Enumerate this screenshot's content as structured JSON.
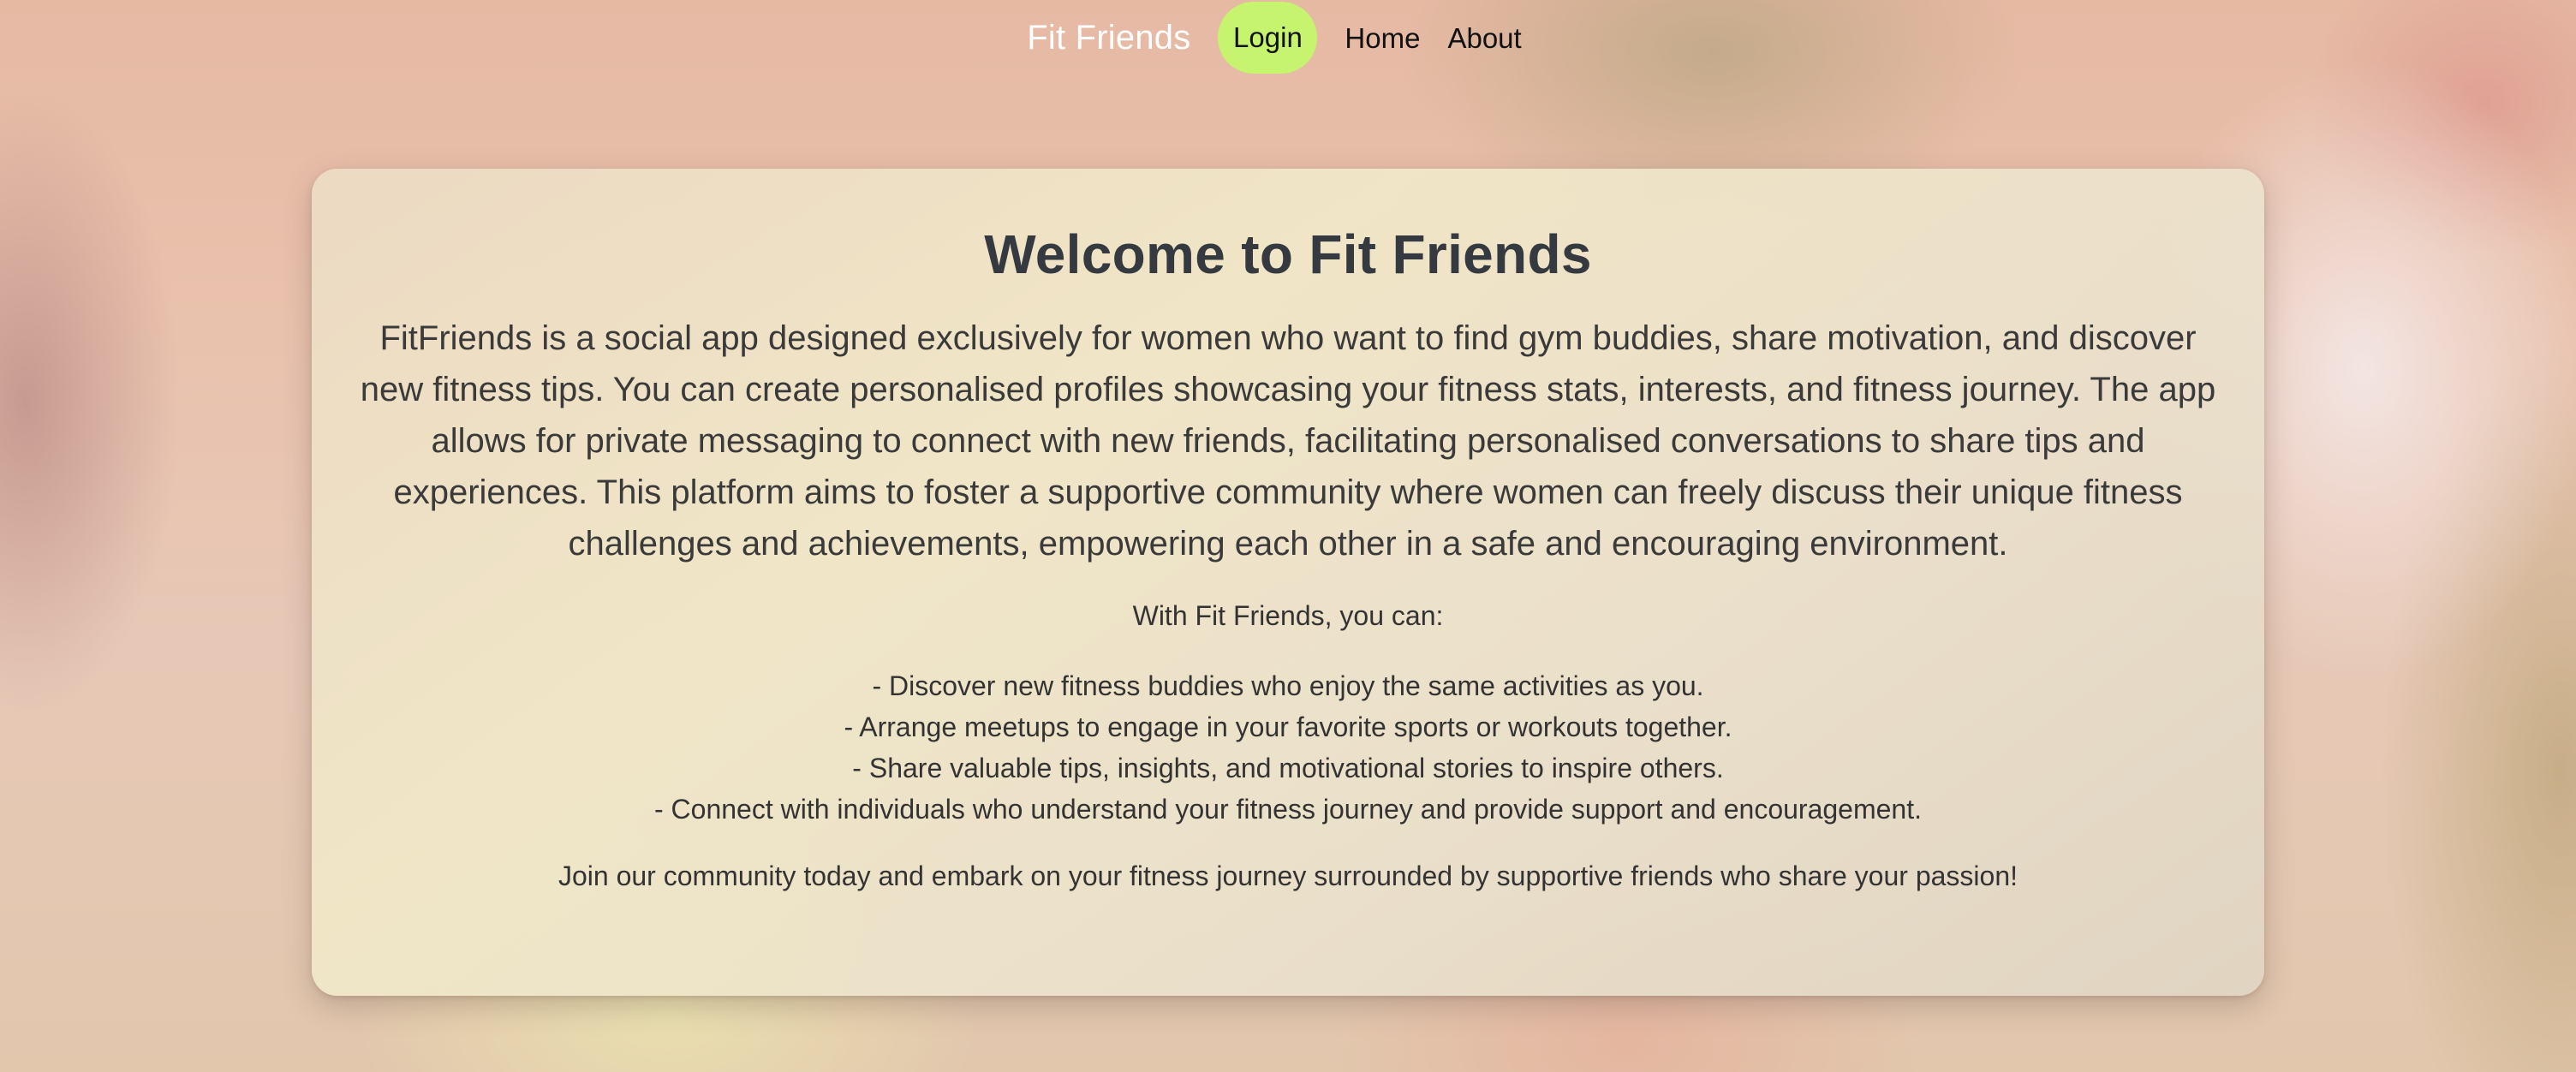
{
  "nav": {
    "brand": "Fit Friends",
    "login": "Login",
    "home": "Home",
    "about": "About",
    "accent_color": "#c6f46e"
  },
  "welcome": {
    "title": "Welcome to Fit Friends",
    "intro": "FitFriends is a social app designed exclusively for women who want to find gym buddies, share motivation, and discover new fitness tips. You can create personalised profiles showcasing your fitness stats, interests, and fitness journey. The app allows for private messaging to connect with new friends, facilitating personalised conversations to share tips and experiences. This platform aims to foster a supportive community where women can freely discuss their unique fitness challenges and achievements, empowering each other in a safe and encouraging environment.",
    "subhead": "With Fit Friends, you can:",
    "features": [
      "- Discover new fitness buddies who enjoy the same activities as you.",
      "- Arrange meetups to engage in your favorite sports or workouts together.",
      "- Share valuable tips, insights, and motivational stories to inspire others.",
      "- Connect with individuals who understand your fitness journey and provide support and encouragement."
    ],
    "outro": "Join our community today and embark on your fitness journey surrounded by supportive friends who share your passion!"
  }
}
